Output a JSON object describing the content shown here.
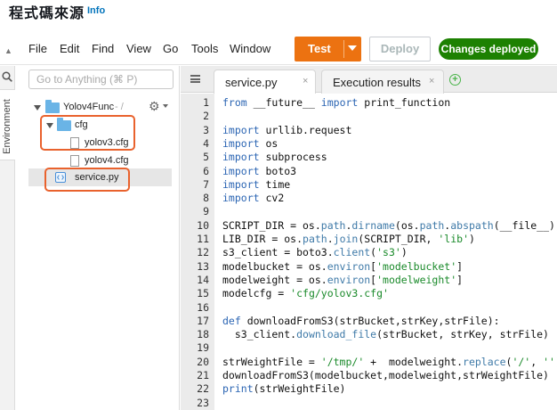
{
  "header": {
    "title": "程式碼來源",
    "info": "Info"
  },
  "menu": {
    "items": [
      "File",
      "Edit",
      "Find",
      "View",
      "Go",
      "Tools",
      "Window"
    ],
    "test_label": "Test",
    "deploy_label": "Deploy",
    "status_badge": "Changes deployed"
  },
  "rail": {
    "label": "Environment"
  },
  "tree": {
    "goto_placeholder": "Go to Anything (⌘ P)",
    "root": "Yolov4Func",
    "root_suffix": "- /",
    "folder_cfg": "cfg",
    "file_yolov3": "yolov3.cfg",
    "file_yolov4": "yolov4.cfg",
    "file_service": "service.py"
  },
  "editor": {
    "tabs": [
      {
        "label": "service.py",
        "close": "×"
      },
      {
        "label": "Execution results",
        "close": "×"
      }
    ],
    "add_tab": "+",
    "line_numbers": [
      "1",
      "2",
      "3",
      "4",
      "5",
      "6",
      "7",
      "8",
      "9",
      "10",
      "11",
      "12",
      "13",
      "14",
      "15",
      "16",
      "17",
      "18",
      "19",
      "20",
      "21",
      "22",
      "23"
    ],
    "lines": [
      [
        [
          "kw",
          "from"
        ],
        [
          "plain",
          " __future__ "
        ],
        [
          "kw",
          "import"
        ],
        [
          "plain",
          " print_function"
        ]
      ],
      [],
      [
        [
          "kw",
          "import"
        ],
        [
          "plain",
          " urllib.request"
        ]
      ],
      [
        [
          "kw",
          "import"
        ],
        [
          "plain",
          " os"
        ]
      ],
      [
        [
          "kw",
          "import"
        ],
        [
          "plain",
          " subprocess"
        ]
      ],
      [
        [
          "kw",
          "import"
        ],
        [
          "plain",
          " boto3"
        ]
      ],
      [
        [
          "kw",
          "import"
        ],
        [
          "plain",
          " time"
        ]
      ],
      [
        [
          "kw",
          "import"
        ],
        [
          "plain",
          " cv2"
        ]
      ],
      [],
      [
        [
          "plain",
          "SCRIPT_DIR = os."
        ],
        [
          "fn",
          "path"
        ],
        [
          "plain",
          "."
        ],
        [
          "fn",
          "dirname"
        ],
        [
          "plain",
          "(os."
        ],
        [
          "fn",
          "path"
        ],
        [
          "plain",
          "."
        ],
        [
          "fn",
          "abspath"
        ],
        [
          "plain",
          "(__file__))"
        ]
      ],
      [
        [
          "plain",
          "LIB_DIR = os."
        ],
        [
          "fn",
          "path"
        ],
        [
          "plain",
          "."
        ],
        [
          "fn",
          "join"
        ],
        [
          "plain",
          "(SCRIPT_DIR, "
        ],
        [
          "str",
          "'lib'"
        ],
        [
          "plain",
          ")"
        ]
      ],
      [
        [
          "plain",
          "s3_client = boto3."
        ],
        [
          "fn",
          "client"
        ],
        [
          "plain",
          "("
        ],
        [
          "str",
          "'s3'"
        ],
        [
          "plain",
          ")"
        ]
      ],
      [
        [
          "plain",
          "modelbucket = os."
        ],
        [
          "fn",
          "environ"
        ],
        [
          "plain",
          "["
        ],
        [
          "str",
          "'modelbucket'"
        ],
        [
          "plain",
          "]"
        ]
      ],
      [
        [
          "plain",
          "modelweight = os."
        ],
        [
          "fn",
          "environ"
        ],
        [
          "plain",
          "["
        ],
        [
          "str",
          "'modelweight'"
        ],
        [
          "plain",
          "]"
        ]
      ],
      [
        [
          "plain",
          "modelcfg = "
        ],
        [
          "str",
          "'cfg/yolov3.cfg'"
        ]
      ],
      [],
      [
        [
          "kw",
          "def"
        ],
        [
          "plain",
          " downloadFromS3(strBucket,strKey,strFile):"
        ]
      ],
      [
        [
          "plain",
          "  s3_client."
        ],
        [
          "fn",
          "download_file"
        ],
        [
          "plain",
          "(strBucket, strKey, strFile)"
        ]
      ],
      [],
      [
        [
          "plain",
          "strWeightFile = "
        ],
        [
          "str",
          "'/tmp/'"
        ],
        [
          "plain",
          " +  modelweight."
        ],
        [
          "fn",
          "replace"
        ],
        [
          "plain",
          "("
        ],
        [
          "str",
          "'/'"
        ],
        [
          "plain",
          ", "
        ],
        [
          "str",
          "''"
        ],
        [
          "plain",
          ")"
        ]
      ],
      [
        [
          "plain",
          "downloadFromS3(modelbucket,modelweight,strWeightFile)"
        ]
      ],
      [
        [
          "kw",
          "print"
        ],
        [
          "plain",
          "(strWeightFile)"
        ]
      ],
      []
    ]
  },
  "colors": {
    "accent_orange": "#ec7211",
    "success_green": "#1d8102",
    "highlight_box": "#e9622d",
    "link_blue": "#0073bb"
  }
}
